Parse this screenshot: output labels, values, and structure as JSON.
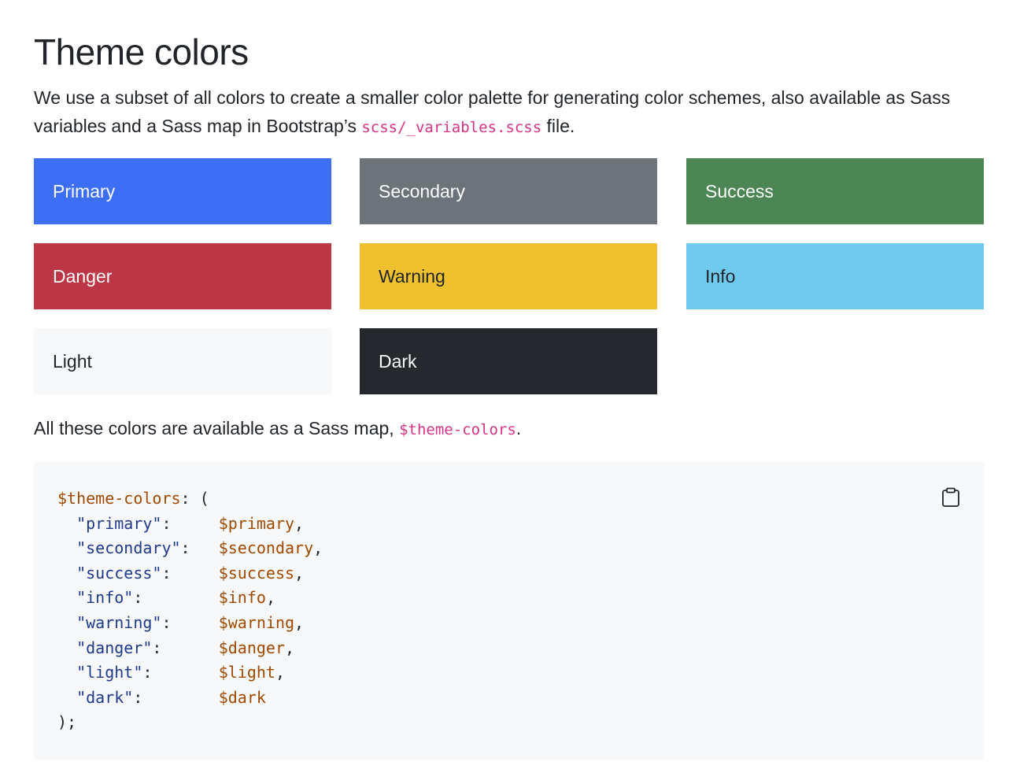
{
  "page": {
    "title": "Theme colors",
    "intro_text": "We use a subset of all colors to create a smaller color palette for generating color schemes, also available as Sass variables and a Sass map in Bootstrap’s",
    "intro_code": "scss/_variables.scss",
    "intro_suffix": " file."
  },
  "swatches": [
    {
      "label": "Primary",
      "bg": "#3d6ff5",
      "fg": "#ffffff"
    },
    {
      "label": "Secondary",
      "bg": "#6c737b",
      "fg": "#ffffff"
    },
    {
      "label": "Success",
      "bg": "#4c8655",
      "fg": "#ffffff"
    },
    {
      "label": "Danger",
      "bg": "#bd3645",
      "fg": "#ffffff"
    },
    {
      "label": "Warning",
      "bg": "#f0c02f",
      "fg": "#212529"
    },
    {
      "label": "Info",
      "bg": "#70c9ee",
      "fg": "#212529"
    },
    {
      "label": "Light",
      "bg": "#f7f8fa",
      "fg": "#212529"
    },
    {
      "label": "Dark",
      "bg": "#25292d",
      "fg": "#ffffff"
    }
  ],
  "sass_note": {
    "prefix": "All these colors are available as a Sass map, ",
    "code": "$theme-colors",
    "suffix": "."
  },
  "code": {
    "map_name": "$theme-colors",
    "open": ": (",
    "close": ");",
    "entries": [
      {
        "key": "\"primary\"",
        "value": "$primary",
        "trail": ","
      },
      {
        "key": "\"secondary\"",
        "value": "$secondary",
        "trail": ","
      },
      {
        "key": "\"success\"",
        "value": "$success",
        "trail": ","
      },
      {
        "key": "\"info\"",
        "value": "$info",
        "trail": ","
      },
      {
        "key": "\"warning\"",
        "value": "$warning",
        "trail": ","
      },
      {
        "key": "\"danger\"",
        "value": "$danger",
        "trail": ","
      },
      {
        "key": "\"light\"",
        "value": "$light",
        "trail": ","
      },
      {
        "key": "\"dark\"",
        "value": "$dark",
        "trail": ""
      }
    ],
    "copy_icon": "clipboard-icon"
  },
  "colors": {
    "text": "#212529",
    "inline_code": "#d63384",
    "code_bg": "#f7f8fa",
    "token_variable": "#a04900",
    "token_string": "#1f3a8a"
  }
}
